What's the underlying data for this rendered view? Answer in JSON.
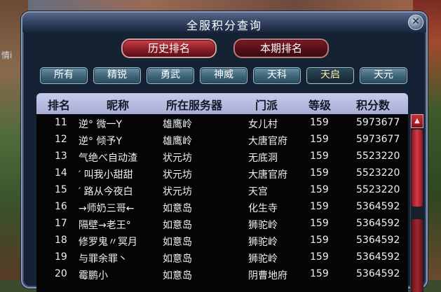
{
  "background": {
    "side_text": "情i"
  },
  "window": {
    "title": "全服积分查询",
    "close_label": "✕"
  },
  "rank_tabs": {
    "history": "历史排名",
    "current": "本期排名"
  },
  "schools": [
    "所有",
    "精锐",
    "勇武",
    "神威",
    "天科",
    "天启",
    "天元"
  ],
  "active_school": "天启",
  "table": {
    "headers": [
      "排名",
      "昵称",
      "所在服务器",
      "门派",
      "等级",
      "积分数"
    ],
    "rows": [
      {
        "rank": "11",
        "name": "逆° 微一Y",
        "server": "雄鹰岭",
        "school": "女儿村",
        "level": "159",
        "score": "5973677"
      },
      {
        "rank": "12",
        "name": "逆° 倾予Y",
        "server": "雄鹰岭",
        "school": "大唐官府",
        "level": "159",
        "score": "5973677"
      },
      {
        "rank": "13",
        "name": "气绝べ自动渣",
        "server": "状元坊",
        "school": "无底洞",
        "level": "159",
        "score": "5523220"
      },
      {
        "rank": "14",
        "name": "′ 叫我小甜甜",
        "server": "状元坊",
        "school": "大唐官府",
        "level": "159",
        "score": "5523220"
      },
      {
        "rank": "15",
        "name": "′ 路从今夜白",
        "server": "状元坊",
        "school": "天宫",
        "level": "159",
        "score": "5523220"
      },
      {
        "rank": "16",
        "name": "→师奶三哥←",
        "server": "如意岛",
        "school": "化生寺",
        "level": "159",
        "score": "5364592"
      },
      {
        "rank": "17",
        "name": "隔壁→老王°",
        "server": "如意岛",
        "school": "狮驼岭",
        "level": "159",
        "score": "5364592"
      },
      {
        "rank": "18",
        "name": "修罗鬼〃冥月",
        "server": "如意岛",
        "school": "狮驼岭",
        "level": "159",
        "score": "5364592"
      },
      {
        "rank": "19",
        "name": "与罪余罪丶",
        "server": "如意岛",
        "school": "狮驼岭",
        "level": "159",
        "score": "5364592"
      },
      {
        "rank": "20",
        "name": "霉鹏小",
        "server": "如意岛",
        "school": "阴曹地府",
        "level": "159",
        "score": "5364592"
      }
    ]
  },
  "scrollbar": {
    "up_arrow": "▲"
  }
}
